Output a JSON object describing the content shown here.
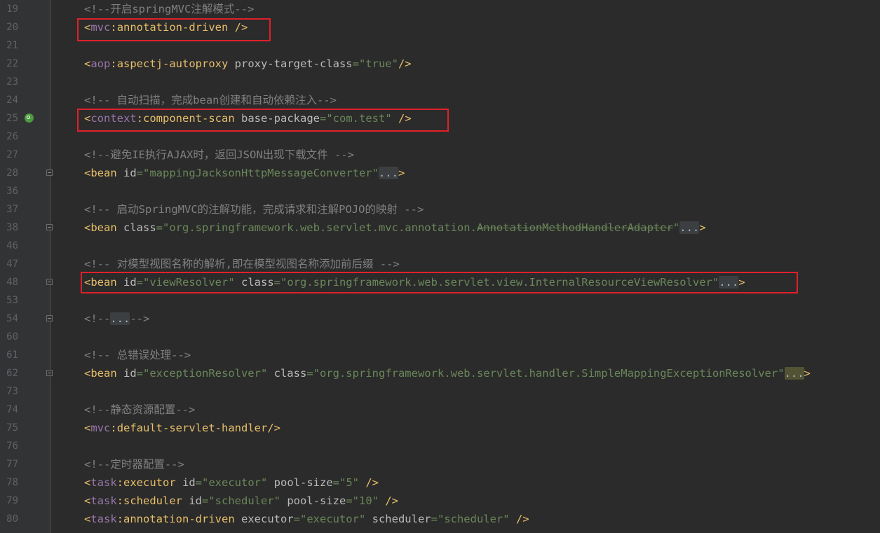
{
  "editor": {
    "colors": {
      "background": "#2b2b2b",
      "gutter": "#313335",
      "highlight_box": "#e0202a",
      "tag": "#e8bf6a",
      "namespace": "#9876aa",
      "value": "#6a8759",
      "comment": "#808080"
    },
    "gutter_icon": "search-bean-icon",
    "lines": [
      {
        "n": "19",
        "fold": false,
        "icon": false,
        "tokens": [
          {
            "c": "cmt",
            "t": "<!--开启springMVC注解模式-->"
          }
        ]
      },
      {
        "n": "20",
        "fold": false,
        "icon": false,
        "tokens": [
          {
            "c": "brk",
            "t": "<"
          },
          {
            "c": "ns",
            "t": "mvc"
          },
          {
            "c": "brk",
            "t": ":"
          },
          {
            "c": "tag",
            "t": "annotation-driven"
          },
          {
            "c": "brk",
            "t": " />"
          }
        ]
      },
      {
        "n": "21",
        "fold": false,
        "icon": false,
        "tokens": []
      },
      {
        "n": "22",
        "fold": false,
        "icon": false,
        "tokens": [
          {
            "c": "brk",
            "t": "<"
          },
          {
            "c": "ns",
            "t": "aop"
          },
          {
            "c": "brk",
            "t": ":"
          },
          {
            "c": "tag",
            "t": "aspectj-autoproxy"
          },
          {
            "c": "attr",
            "t": " proxy-target-class"
          },
          {
            "c": "val",
            "t": "=\"true\""
          },
          {
            "c": "brk",
            "t": "/>"
          }
        ]
      },
      {
        "n": "23",
        "fold": false,
        "icon": false,
        "tokens": []
      },
      {
        "n": "24",
        "fold": false,
        "icon": false,
        "tokens": [
          {
            "c": "cmt",
            "t": "<!-- 自动扫描，完成bean创建和自动依赖注入-->"
          }
        ]
      },
      {
        "n": "25",
        "fold": false,
        "icon": true,
        "tokens": [
          {
            "c": "brk",
            "t": "<"
          },
          {
            "c": "ns",
            "t": "context"
          },
          {
            "c": "brk",
            "t": ":"
          },
          {
            "c": "tag",
            "t": "component-scan"
          },
          {
            "c": "attr",
            "t": " base-package"
          },
          {
            "c": "val",
            "t": "=\"com.test\""
          },
          {
            "c": "brk",
            "t": " />"
          }
        ]
      },
      {
        "n": "26",
        "fold": false,
        "icon": false,
        "tokens": []
      },
      {
        "n": "27",
        "fold": false,
        "icon": false,
        "tokens": [
          {
            "c": "cmt",
            "t": "<!--避免IE执行AJAX时，返回JSON出现下载文件 -->"
          }
        ]
      },
      {
        "n": "28",
        "fold": true,
        "icon": false,
        "tokens": [
          {
            "c": "brk",
            "t": "<"
          },
          {
            "c": "tag",
            "t": "bean"
          },
          {
            "c": "attr",
            "t": " id"
          },
          {
            "c": "val",
            "t": "=\"mappingJacksonHttpMessageConverter\""
          },
          {
            "c": "fold",
            "t": "..."
          },
          {
            "c": "brk",
            "t": ">"
          }
        ]
      },
      {
        "n": "36",
        "fold": false,
        "icon": false,
        "tokens": []
      },
      {
        "n": "37",
        "fold": false,
        "icon": false,
        "tokens": [
          {
            "c": "cmt",
            "t": "<!-- 启动SpringMVC的注解功能，完成请求和注解POJO的映射 -->"
          }
        ]
      },
      {
        "n": "38",
        "fold": true,
        "icon": false,
        "tokens": [
          {
            "c": "brk",
            "t": "<"
          },
          {
            "c": "tag",
            "t": "bean"
          },
          {
            "c": "attr",
            "t": " class"
          },
          {
            "c": "val",
            "t": "=\"org.springframework.web.servlet.mvc.annotation."
          },
          {
            "c": "strike",
            "t": "AnnotationMethodHandlerAdapter"
          },
          {
            "c": "val",
            "t": "\""
          },
          {
            "c": "fold",
            "t": "..."
          },
          {
            "c": "brk",
            "t": ">"
          }
        ]
      },
      {
        "n": "46",
        "fold": false,
        "icon": false,
        "tokens": []
      },
      {
        "n": "47",
        "fold": false,
        "icon": false,
        "tokens": [
          {
            "c": "cmt",
            "t": "<!-- 对模型视图名称的解析,即在模型视图名称添加前后缀 -->"
          }
        ]
      },
      {
        "n": "48",
        "fold": true,
        "icon": false,
        "tokens": [
          {
            "c": "brk",
            "t": "<"
          },
          {
            "c": "tag",
            "t": "bean"
          },
          {
            "c": "attr",
            "t": " id"
          },
          {
            "c": "val",
            "t": "=\"viewResolver\""
          },
          {
            "c": "attr",
            "t": " class"
          },
          {
            "c": "val",
            "t": "=\"org.springframework.web.servlet.view.InternalResourceViewResolver\""
          },
          {
            "c": "fold",
            "t": "..."
          },
          {
            "c": "brk",
            "t": ">"
          }
        ]
      },
      {
        "n": "53",
        "fold": false,
        "icon": false,
        "tokens": []
      },
      {
        "n": "54",
        "fold": true,
        "icon": false,
        "tokens": [
          {
            "c": "cmt",
            "t": "<!--"
          },
          {
            "c": "fold",
            "t": "..."
          },
          {
            "c": "cmt",
            "t": "-->"
          }
        ]
      },
      {
        "n": "60",
        "fold": false,
        "icon": false,
        "tokens": []
      },
      {
        "n": "61",
        "fold": false,
        "icon": false,
        "tokens": [
          {
            "c": "cmt",
            "t": "<!-- 总错误处理-->"
          }
        ]
      },
      {
        "n": "62",
        "fold": true,
        "icon": false,
        "tokens": [
          {
            "c": "brk",
            "t": "<"
          },
          {
            "c": "tag",
            "t": "bean"
          },
          {
            "c": "attr",
            "t": " id"
          },
          {
            "c": "val",
            "t": "=\"exceptionResolver\""
          },
          {
            "c": "attr",
            "t": " class"
          },
          {
            "c": "val",
            "t": "=\"org.springframework.web.servlet.handler.SimpleMappingExceptionResolver\""
          },
          {
            "c": "foldh",
            "t": "..."
          },
          {
            "c": "brk",
            "t": ">"
          }
        ]
      },
      {
        "n": "73",
        "fold": false,
        "icon": false,
        "tokens": []
      },
      {
        "n": "74",
        "fold": false,
        "icon": false,
        "tokens": [
          {
            "c": "cmt",
            "t": "<!--静态资源配置-->"
          }
        ]
      },
      {
        "n": "75",
        "fold": false,
        "icon": false,
        "tokens": [
          {
            "c": "brk",
            "t": "<"
          },
          {
            "c": "ns",
            "t": "mvc"
          },
          {
            "c": "brk",
            "t": ":"
          },
          {
            "c": "tag",
            "t": "default-servlet-handler"
          },
          {
            "c": "brk",
            "t": "/>"
          }
        ]
      },
      {
        "n": "76",
        "fold": false,
        "icon": false,
        "tokens": []
      },
      {
        "n": "77",
        "fold": false,
        "icon": false,
        "tokens": [
          {
            "c": "cmt",
            "t": "<!--定时器配置-->"
          }
        ]
      },
      {
        "n": "78",
        "fold": false,
        "icon": false,
        "tokens": [
          {
            "c": "brk",
            "t": "<"
          },
          {
            "c": "ns",
            "t": "task"
          },
          {
            "c": "brk",
            "t": ":"
          },
          {
            "c": "tag",
            "t": "executor"
          },
          {
            "c": "attr",
            "t": " id"
          },
          {
            "c": "val",
            "t": "=\"executor\""
          },
          {
            "c": "attr",
            "t": " pool-size"
          },
          {
            "c": "val",
            "t": "=\"5\""
          },
          {
            "c": "brk",
            "t": " />"
          }
        ]
      },
      {
        "n": "79",
        "fold": false,
        "icon": false,
        "tokens": [
          {
            "c": "brk",
            "t": "<"
          },
          {
            "c": "ns",
            "t": "task"
          },
          {
            "c": "brk",
            "t": ":"
          },
          {
            "c": "tag",
            "t": "scheduler"
          },
          {
            "c": "attr",
            "t": " id"
          },
          {
            "c": "val",
            "t": "=\"scheduler\""
          },
          {
            "c": "attr",
            "t": " pool-size"
          },
          {
            "c": "val",
            "t": "=\"10\""
          },
          {
            "c": "brk",
            "t": " />"
          }
        ]
      },
      {
        "n": "80",
        "fold": false,
        "icon": false,
        "tokens": [
          {
            "c": "brk",
            "t": "<"
          },
          {
            "c": "ns",
            "t": "task"
          },
          {
            "c": "brk",
            "t": ":"
          },
          {
            "c": "tag",
            "t": "annotation-driven"
          },
          {
            "c": "attr",
            "t": " executor"
          },
          {
            "c": "val",
            "t": "=\"executor\""
          },
          {
            "c": "attr",
            "t": " scheduler"
          },
          {
            "c": "val",
            "t": "=\"scheduler\""
          },
          {
            "c": "brk",
            "t": " />"
          }
        ]
      }
    ]
  }
}
